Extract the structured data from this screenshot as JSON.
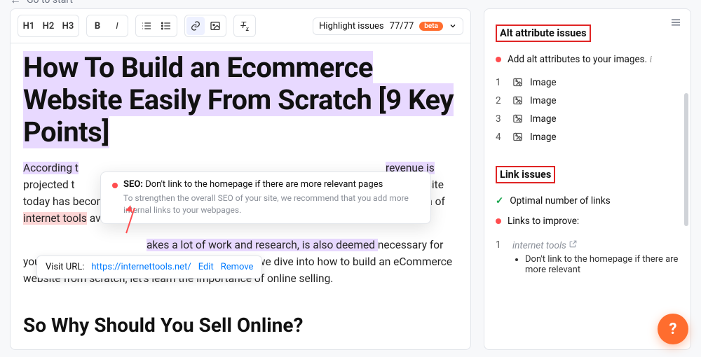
{
  "top": {
    "goToStart": "Go to start"
  },
  "toolbar": {
    "h1": "H1",
    "h2": "H2",
    "h3": "H3",
    "highlight_label": "Highlight issues",
    "count": "77/77",
    "beta": "beta"
  },
  "article": {
    "title": "How To Build an Ecommerce Website Easily From Scratch [9 Key Points]",
    "p1_a": "According t",
    "p1_b": "revenue is ",
    "p1_c": "projected t",
    "p1_d": "mmerce website today has become a lot less complicated with time. This is mainly due to the plethora of ",
    "p1_link": "internet tools",
    "p1_e": " available to do so.",
    "p2_a": "akes a lot of work and research, is also deemed ",
    "p2_b": "necessary for your ecommerce business to take off. So before we dive into how to build an eCommerce website from scratch, let's learn the importance of online selling.",
    "h2": "So Why Should You Sell Online?"
  },
  "tooltip": {
    "tag": "SEO:",
    "msg": "Don't link to the homepage if there are more relevant pages",
    "detail": "To strengthen the overall SEO of your site, we recommend that you add more internal links to your webpages."
  },
  "linkpop": {
    "label": "Visit URL:",
    "url": "https://internettools.net/",
    "edit": "Edit",
    "remove": "Remove"
  },
  "sidebar": {
    "alt_title": "Alt attribute issues",
    "alt_issue": "Add alt attributes to your images.",
    "images": [
      "Image",
      "Image",
      "Image",
      "Image"
    ],
    "link_title": "Link issues",
    "link_ok": "Optimal number of links",
    "link_improve": "Links to improve:",
    "link_items": [
      {
        "name": "internet tools",
        "bullet": "Don't link to the homepage if there are more relevant"
      }
    ]
  },
  "help": "?"
}
